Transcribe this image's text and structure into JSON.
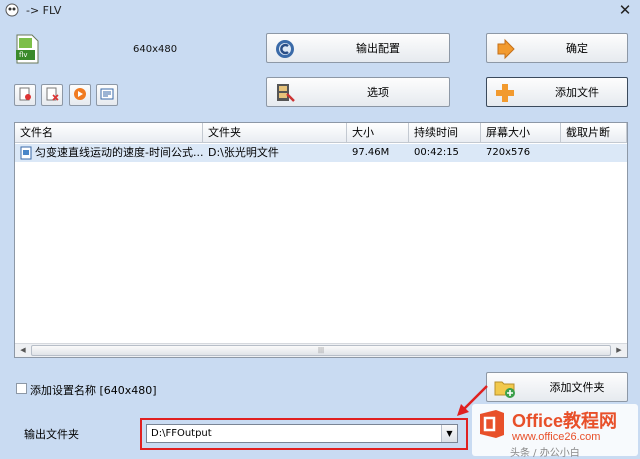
{
  "window": {
    "title": "-> FLV",
    "close_glyph": "✕"
  },
  "format": {
    "icon_text": "flv",
    "resolution": "640x480"
  },
  "buttons": {
    "output_config": "输出配置",
    "options": "选项",
    "confirm": "确定",
    "add_file": "添加文件",
    "add_folder": "添加文件夹"
  },
  "small_tools": [
    {
      "name": "remove-icon"
    },
    {
      "name": "clear-icon"
    },
    {
      "name": "play-icon"
    },
    {
      "name": "info-icon"
    }
  ],
  "file_list": {
    "columns": [
      "文件名",
      "文件夹",
      "大小",
      "持续时间",
      "屏幕大小",
      "截取片断"
    ],
    "rows": [
      {
        "name": "匀变速直线运动的速度-时间公式...",
        "folder": "D:\\张光明文件",
        "size": "97.46M",
        "duration": "00:42:15",
        "screen": "720x576",
        "clip": ""
      }
    ],
    "scroll_glyphs": {
      "left": "◀",
      "thumb": "|||",
      "right": "▶"
    }
  },
  "settings": {
    "add_name_label": "添加设置名称 [640x480]",
    "add_name_checked": false
  },
  "output": {
    "label": "输出文件夹",
    "path": "D:\\FFOutput",
    "arrow_glyph": "▼"
  },
  "watermark": {
    "brand": "Office教程网",
    "url": "www.office26.com",
    "caption": "头条 / 办公小白"
  },
  "colors": {
    "background": "#c9dbf2",
    "highlight_box": "#e02020",
    "selected_row": "#dbe8f7"
  }
}
